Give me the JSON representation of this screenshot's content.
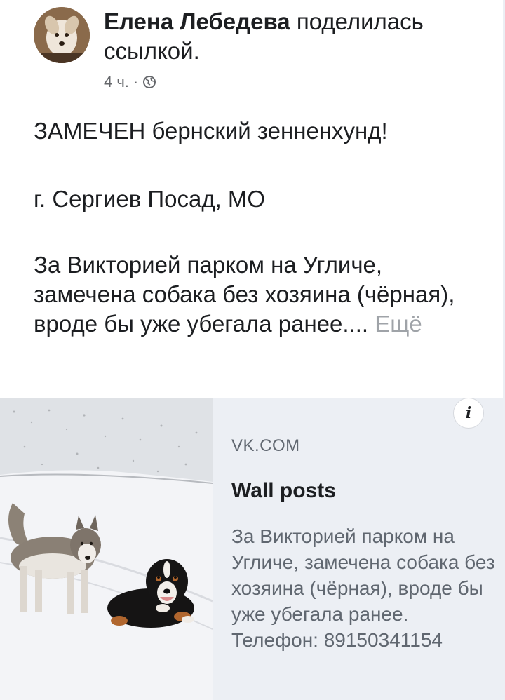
{
  "post": {
    "author": "Елена Лебедева",
    "action": "поделилась ссылкой.",
    "time": "4 ч.",
    "separator": "·",
    "privacy_icon": "globe-icon",
    "paragraphs": [
      "ЗАМЕЧЕН бернский зенненхунд!",
      "г. Сергиев Посад, МО",
      "За Викторией парком на Угличе, замечена собака без хозяина (чёрная), вроде бы уже убегала ранее...."
    ],
    "see_more": "Ещё"
  },
  "link_card": {
    "domain": "VK.COM",
    "title": "Wall posts",
    "description": "За Викторией парком на Угличе, замечена собака без хозяина (чёрная), вроде бы уже убегала ранее. Телефон: 89150341154",
    "info_icon": "info-icon",
    "info_label": "i",
    "image_alt": "husky and bernese mountain dog in snow"
  },
  "colors": {
    "text": "#1c1e21",
    "secondary": "#65676b",
    "card_bg": "#eceff4"
  }
}
